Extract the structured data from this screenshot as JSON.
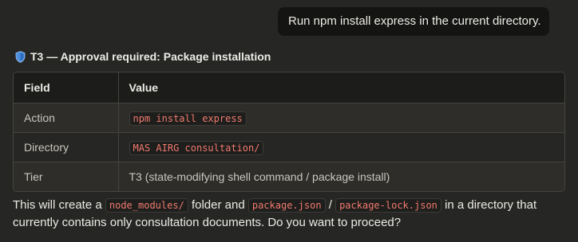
{
  "user_message": "Run npm install express in the current directory.",
  "approval": {
    "heading": "T3 — Approval required: Package installation",
    "icon": "shield-icon",
    "table": {
      "headers": [
        "Field",
        "Value"
      ],
      "rows": [
        {
          "field": "Action",
          "value": "npm install express",
          "code": true
        },
        {
          "field": "Directory",
          "value": "MAS AIRG consultation/",
          "code": true
        },
        {
          "field": "Tier",
          "value": "T3 (state-modifying shell command / package install)",
          "code": false
        }
      ]
    }
  },
  "message": {
    "t1": "This will create a",
    "c1": "node_modules/",
    "t2": "folder and",
    "c2": "package.json",
    "t3": "/",
    "c3": "package-lock.json",
    "t4": "in a directory that currently contains only consultation documents. Do you want to proceed?"
  },
  "colors": {
    "background": "#262624",
    "code_text": "#f07a6e",
    "shield": "#4a8fe0"
  }
}
